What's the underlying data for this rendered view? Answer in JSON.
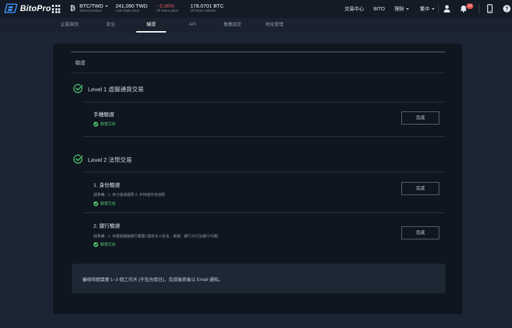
{
  "brand": {
    "name": "BitoPro"
  },
  "ticker": {
    "pair": "BTC/TWD",
    "pair_sub": "Select product",
    "last_price": "241,090 TWD",
    "last_price_sub": "Last trade price",
    "change": "- 0.36%",
    "change_sub": "24 hours price",
    "volume": "178.0701 BTC",
    "volume_sub": "24 hours volume"
  },
  "nav": {
    "exchange": "交易中心",
    "bito": "BITO",
    "assets": "理財",
    "language": "繁中",
    "notification_count": "15"
  },
  "tabs": [
    {
      "label": "企業資訊",
      "active": false
    },
    {
      "label": "安全",
      "active": false
    },
    {
      "label": "驗證",
      "active": true
    },
    {
      "label": "API",
      "active": false
    },
    {
      "label": "推薦設定",
      "active": false
    },
    {
      "label": "地址管理",
      "active": false
    }
  ],
  "card": {
    "title": "驗證",
    "level1": {
      "title": "Level 1 虛擬通貨交易",
      "items": [
        {
          "title": "手機驗證",
          "desc": "",
          "status": "驗證完成",
          "button": "完成"
        }
      ]
    },
    "level2": {
      "title": "Level 2 法幣交易",
      "items": [
        {
          "title": "1. 身份驗證",
          "desc": "請準備：1. 身分證或護照   2. 手持證件自拍照",
          "status": "驗證完成",
          "button": "完成"
        },
        {
          "title": "2. 銀行驗證",
          "desc": "請準備：1. 存摺或網路銀行截圖 (需有本人姓名、帳號、銀行分行及銀行代碼)",
          "status": "驗證完成",
          "button": "完成"
        }
      ]
    },
    "note": "審核時間需要 1–3 個工作天 (不包含假日)，完成後將會以 Email 通知。"
  },
  "colors": {
    "background": "#1c2533",
    "card": "#0f161f",
    "success": "#4fbf6a",
    "negative": "#e45b5b"
  }
}
